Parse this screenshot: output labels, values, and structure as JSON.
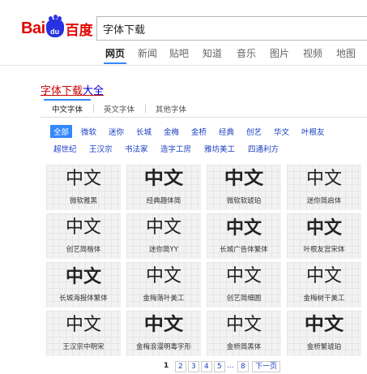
{
  "header": {
    "logo_bai": "Bai",
    "logo_du": "du",
    "logo_cn": "百度",
    "search_value": "字体下载"
  },
  "tabs": [
    "网页",
    "新闻",
    "贴吧",
    "知道",
    "音乐",
    "图片",
    "视频",
    "地图"
  ],
  "result": {
    "title_main": "字体下载",
    "title_more": "大全"
  },
  "subtabs": [
    "中文字体",
    "英文字体",
    "其他字体"
  ],
  "categories_row1": [
    "全部",
    "微软",
    "迷你",
    "长城",
    "金梅",
    "金桥",
    "经典",
    "创艺",
    "华文",
    "叶根友"
  ],
  "categories_row2": [
    "超世纪",
    "王汉宗",
    "书法家",
    "造字工房",
    "雅坊美工",
    "四通利方"
  ],
  "fonts": [
    {
      "sample": "中文",
      "name": "微软雅黑"
    },
    {
      "sample": "中文",
      "name": "经典趣体简"
    },
    {
      "sample": "中文",
      "name": "微软软琥珀"
    },
    {
      "sample": "中文",
      "name": "迷你简启体"
    },
    {
      "sample": "中文",
      "name": "创艺简楷体"
    },
    {
      "sample": "中文",
      "name": "迷你简YY"
    },
    {
      "sample": "中文",
      "name": "长城广告体繁体"
    },
    {
      "sample": "中文",
      "name": "叶根友宫宋体"
    },
    {
      "sample": "中文",
      "name": "长城海报体繁体"
    },
    {
      "sample": "中文",
      "name": "金梅落叶美工"
    },
    {
      "sample": "中文",
      "name": "创艺简细圆"
    },
    {
      "sample": "中文",
      "name": "金梅树干美工"
    },
    {
      "sample": "中文",
      "name": "王汉宗中明宋"
    },
    {
      "sample": "中文",
      "name": "金梅浪漫明毒字形"
    },
    {
      "sample": "中文",
      "name": "金桥简黑体"
    },
    {
      "sample": "中文",
      "name": "金桥繁琥珀"
    }
  ],
  "pager": {
    "pages": [
      "1",
      "2",
      "3",
      "4",
      "5",
      "...",
      "8"
    ],
    "current": "1",
    "next": "下一页"
  }
}
